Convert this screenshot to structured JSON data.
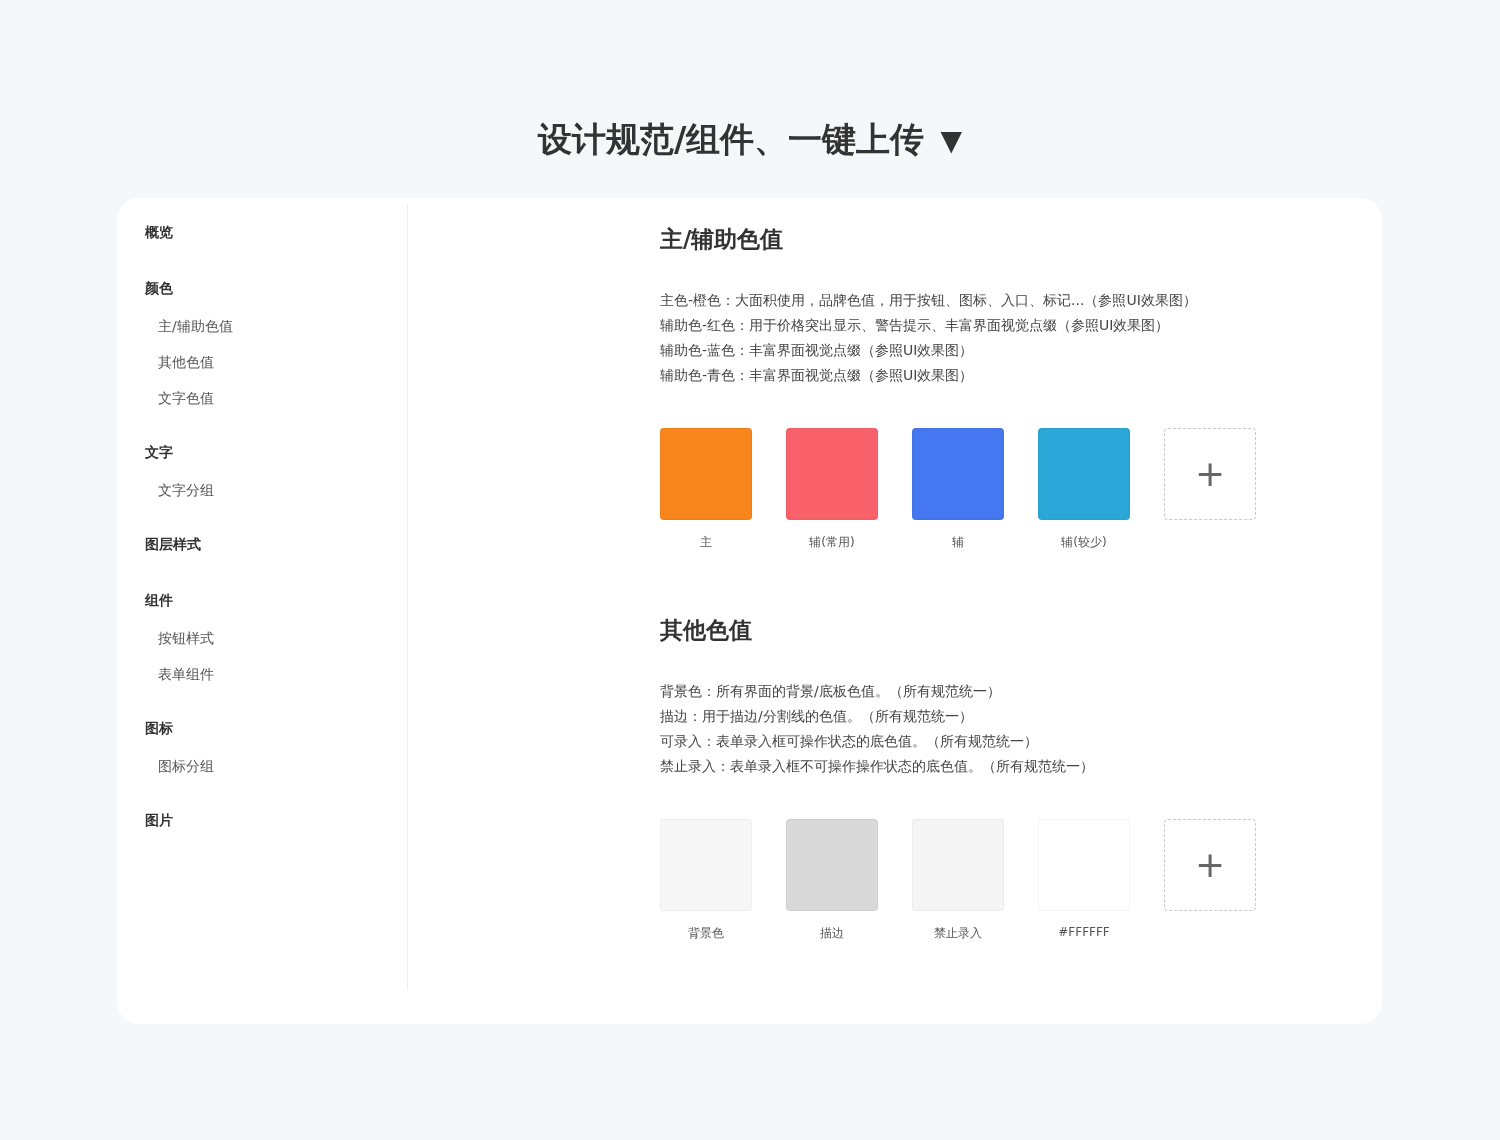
{
  "header": {
    "title": "设计规范/组件、一键上传",
    "caret": "▼"
  },
  "sidebar": {
    "items": [
      {
        "label": "概览"
      },
      {
        "label": "颜色",
        "children": [
          {
            "label": "主/辅助色值"
          },
          {
            "label": "其他色值"
          },
          {
            "label": "文字色值"
          }
        ]
      },
      {
        "label": "文字",
        "children": [
          {
            "label": "文字分组"
          }
        ]
      },
      {
        "label": "图层样式"
      },
      {
        "label": "组件",
        "children": [
          {
            "label": "按钮样式"
          },
          {
            "label": "表单组件"
          }
        ]
      },
      {
        "label": "图标",
        "children": [
          {
            "label": "图标分组"
          }
        ]
      },
      {
        "label": "图片"
      }
    ]
  },
  "sections": [
    {
      "title": "主/辅助色值",
      "lines": [
        "主色-橙色：大面积使用，品牌色值，用于按钮、图标、入口、标记...（参照UI效果图）",
        "辅助色-红色：用于价格突出显示、警告提示、丰富界面视觉点缀（参照UI效果图）",
        "辅助色-蓝色：丰富界面视觉点缀（参照UI效果图）",
        "辅助色-青色：丰富界面视觉点缀（参照UI效果图）"
      ],
      "swatches": [
        {
          "kind": "color",
          "color": "#f8861d",
          "label": "主"
        },
        {
          "kind": "color",
          "color": "#f9616a",
          "label": "辅(常用)"
        },
        {
          "kind": "color",
          "color": "#4477f0",
          "label": "辅"
        },
        {
          "kind": "color",
          "color": "#2aa7d6",
          "label": "辅(较少)"
        },
        {
          "kind": "add",
          "symbol": "+"
        }
      ]
    },
    {
      "title": "其他色值",
      "lines": [
        "背景色：所有界面的背景/底板色值。（所有规范统一）",
        "描边：用于描边/分割线的色值。（所有规范统一）",
        "可录入：表单录入框可操作状态的底色值。（所有规范统一）",
        "禁止录入：表单录入框不可操作操作状态的底色值。（所有规范统一）"
      ],
      "swatches": [
        {
          "kind": "color",
          "color": "#f7f7f7",
          "label": "背景色"
        },
        {
          "kind": "color",
          "color": "#d9d9d9",
          "label": "描边"
        },
        {
          "kind": "color",
          "color": "#f5f5f5",
          "label": "禁止录入"
        },
        {
          "kind": "color",
          "color": "#ffffff",
          "label": "#FFFFFF"
        },
        {
          "kind": "add",
          "symbol": "+"
        }
      ]
    }
  ]
}
